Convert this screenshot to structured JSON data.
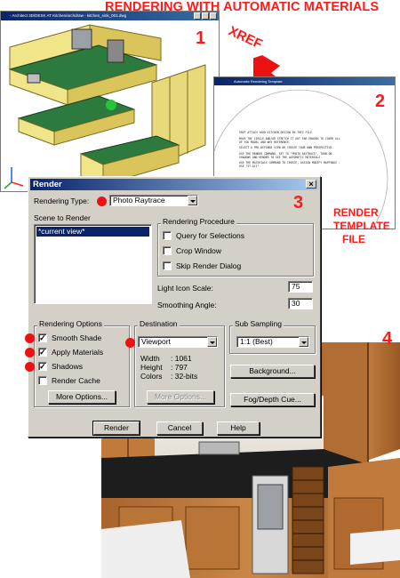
{
  "page": {
    "title": "RENDERING WITH AUTOMATIC MATERIALS",
    "markers": [
      "1",
      "2",
      "3",
      "4"
    ],
    "xref_label": "XREF",
    "render_template_label": [
      "RENDER",
      "TEMPLATE",
      "FILE"
    ],
    "accent_color": "#ff1a1a"
  },
  "window1": {
    "title": "- Architect 3D/DESK AT Kitchen/archdraw - kitchen_sink_001.dwg"
  },
  "window2": {
    "title": "Automatic Rendering Template",
    "notes": [
      "XREF ATTACH YOUR KITCHEN DESIGN IN THIS FILE.",
      "MOVE THE CIRCLE AND/OR STRETCH IT OUT FAR ENOUGH TO COVER ALL OF YOU MODEL AND WHY REFERENCE.",
      "SELECT A PRE-DEFINED VIEW OR CREATE YOUR OWN PERSPECTIVE.",
      "USE THE RENDER COMMAND, SET TO \"PHOTO RAYTRACE\", TURN ON SHADOWS AND RENDER TO SEE THE AUTOMATIC MATERIALS.",
      "USE THE MATERIALS COMMAND TO CREATE, ASSIGN MODIFY MAPPINGS - USE \"ST-ACI\""
    ]
  },
  "dialog": {
    "title": "Render",
    "close_glyph": "×",
    "rendering_type_label": "Rendering Type:",
    "rendering_type_value": "Photo Raytrace",
    "scene_label": "Scene to Render",
    "scene_items": [
      "*current view*"
    ],
    "procedure": {
      "title": "Rendering Procedure",
      "query_label": "Query for Selections",
      "crop_label": "Crop Window",
      "skip_label": "Skip Render Dialog"
    },
    "light_icon_scale_label": "Light Icon Scale:",
    "light_icon_scale_value": "75",
    "smoothing_angle_label": "Smoothing Angle:",
    "smoothing_angle_value": "30",
    "options": {
      "title": "Rendering Options",
      "smooth_shade_label": "Smooth Shade",
      "apply_materials_label": "Apply Materials",
      "shadows_label": "Shadows",
      "render_cache_label": "Render Cache",
      "more_options_label": "More Options...",
      "check_glyph": "✓"
    },
    "destination": {
      "title": "Destination",
      "value": "Viewport",
      "width_label": "Width",
      "width_value": ": 1061",
      "height_label": "Height",
      "height_value": ": 797",
      "colors_label": "Colors",
      "colors_value": ": 32-bits",
      "more_options_label": "More Options..."
    },
    "subsampling": {
      "title": "Sub Sampling",
      "value": "1:1 (Best)"
    },
    "background_label": "Background...",
    "fog_label": "Fog/Depth Cue...",
    "render_label": "Render",
    "cancel_label": "Cancel",
    "help_label": "Help"
  }
}
